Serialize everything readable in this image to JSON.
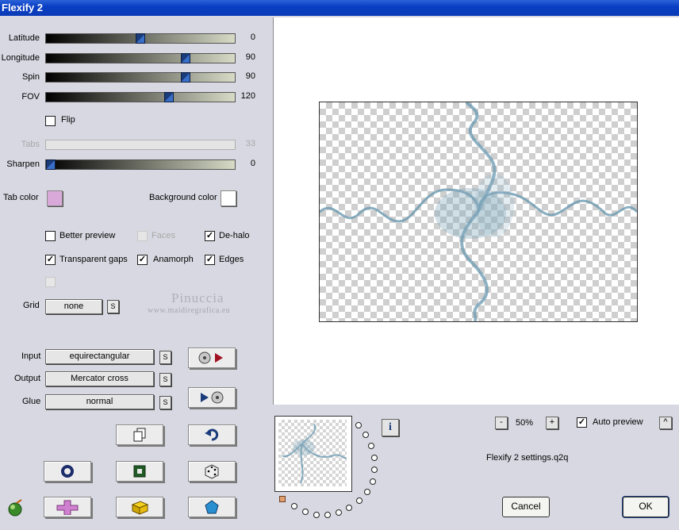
{
  "window": {
    "title": "Flexify 2"
  },
  "sliders": [
    {
      "label": "Latitude",
      "value": "0",
      "fraction": 0.5,
      "enabled": true
    },
    {
      "label": "Longitude",
      "value": "90",
      "fraction": 0.75,
      "enabled": true
    },
    {
      "label": "Spin",
      "value": "90",
      "fraction": 0.75,
      "enabled": true
    },
    {
      "label": "FOV",
      "value": "120",
      "fraction": 0.66,
      "enabled": true
    },
    {
      "label": "Tabs",
      "value": "33",
      "fraction": 0.0,
      "enabled": false
    },
    {
      "label": "Sharpen",
      "value": "0",
      "fraction": 0.0,
      "enabled": true
    }
  ],
  "flip": {
    "label": "Flip",
    "checked": false
  },
  "colors": {
    "tab_label": "Tab color",
    "tab_color": "#d9a9d9",
    "background_label": "Background color",
    "background_color": "#ffffff"
  },
  "options": {
    "better_preview": {
      "label": "Better preview",
      "checked": false
    },
    "faces": {
      "label": "Faces",
      "checked": false
    },
    "de_halo": {
      "label": "De-halo",
      "checked": true
    },
    "transparent_gaps": {
      "label": "Transparent gaps",
      "checked": true
    },
    "anamorph": {
      "label": "Anamorph",
      "checked": true
    },
    "edges": {
      "label": "Edges",
      "checked": true
    }
  },
  "grid": {
    "label": "Grid",
    "value": "none",
    "s": "S"
  },
  "io": {
    "input_label": "Input",
    "input_value": "equirectangular",
    "output_label": "Output",
    "output_value": "Mercator cross",
    "glue_label": "Glue",
    "glue_value": "normal",
    "s": "S"
  },
  "watermark": {
    "line1": "Pinuccia",
    "line2": "www.maidiregrafica.eu"
  },
  "zoom": {
    "minus": "-",
    "value": "50%",
    "plus": "+"
  },
  "auto_preview": {
    "label": "Auto preview",
    "checked": true,
    "caret": "^"
  },
  "settings_file": "Flexify 2 settings.q2q",
  "info": "i",
  "buttons": {
    "cancel": "Cancel",
    "ok": "OK"
  },
  "accent": "#1b3c7a"
}
